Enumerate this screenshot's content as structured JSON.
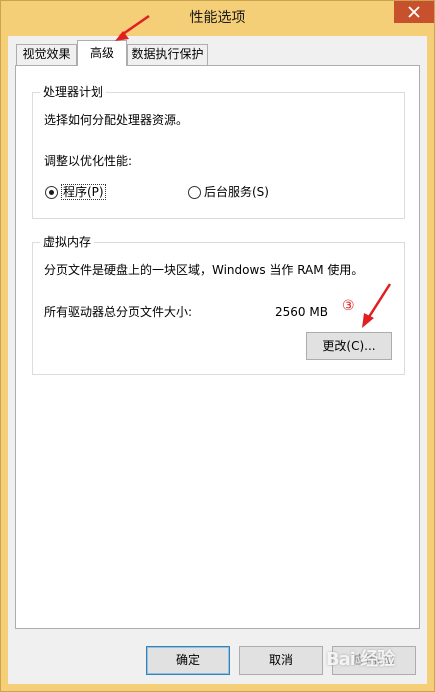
{
  "window": {
    "title": "性能选项",
    "colors": {
      "frame": "#f5cf77",
      "close_button": "#c7502d",
      "annotation": "#e02020"
    }
  },
  "tabs": [
    {
      "label": "视觉效果",
      "active": false
    },
    {
      "label": "高级",
      "active": true
    },
    {
      "label": "数据执行保护",
      "active": false
    }
  ],
  "processor": {
    "title": "处理器计划",
    "description": "选择如何分配处理器资源。",
    "adjust_label": "调整以优化性能:",
    "options": [
      {
        "label": "程序(P)",
        "selected": true
      },
      {
        "label": "后台服务(S)",
        "selected": false
      }
    ]
  },
  "virtual_memory": {
    "title": "虚拟内存",
    "description": "分页文件是硬盘上的一块区域，Windows 当作 RAM 使用。",
    "total_label": "所有驱动器总分页文件大小:",
    "total_value": "2560 MB",
    "change_button": "更改(C)...",
    "step_marker": "③"
  },
  "footer": {
    "ok": "确定",
    "cancel": "取消",
    "apply": "应用(A)"
  }
}
